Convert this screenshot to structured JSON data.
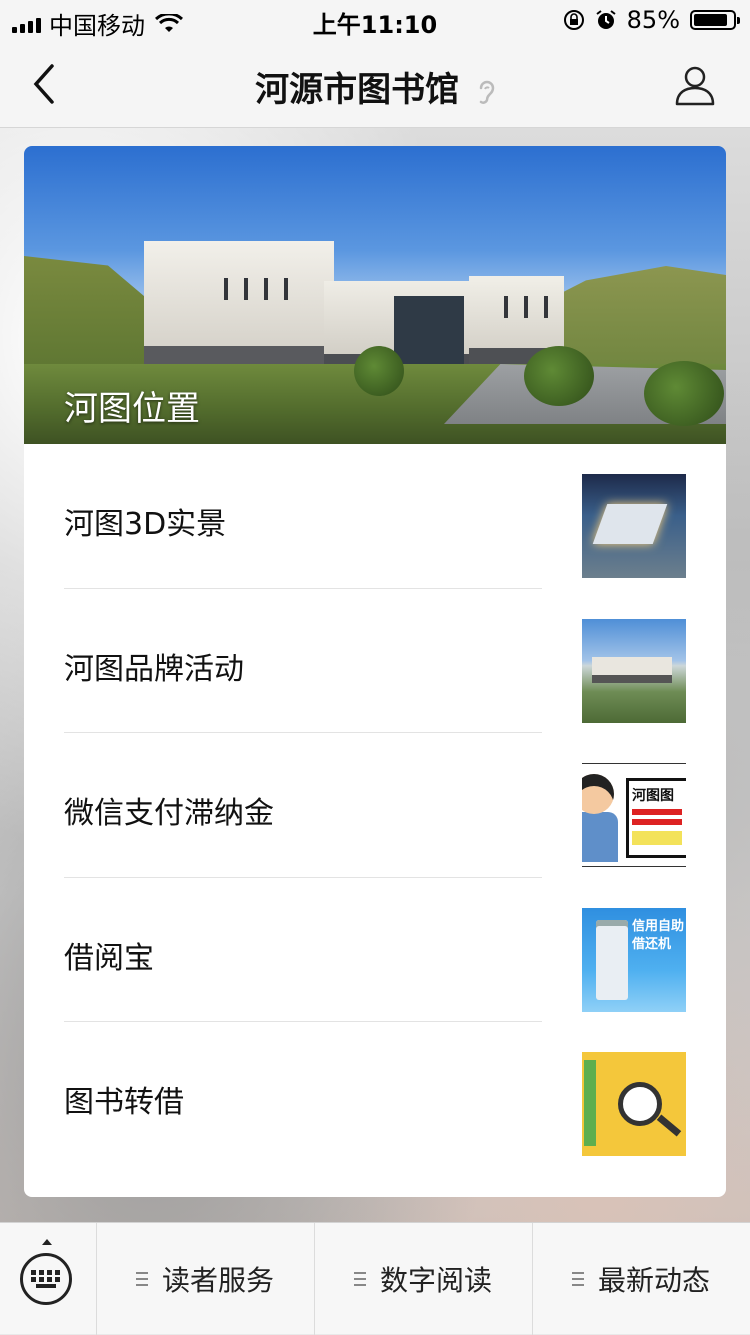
{
  "status_bar": {
    "carrier": "中国移动",
    "time": "上午11:10",
    "battery": "85%"
  },
  "nav": {
    "title": "河源市图书馆"
  },
  "hero": {
    "caption": "河图位置"
  },
  "list": [
    {
      "label": "河图3D实景",
      "thumb": "3d-building-render"
    },
    {
      "label": "河图品牌活动",
      "thumb": "library-photo"
    },
    {
      "label": "微信支付滞纳金",
      "thumb": "cartoon-sign",
      "thumb_text": "河图图"
    },
    {
      "label": "借阅宝",
      "thumb": "self-service-kiosk",
      "thumb_text": "信用自助 借还机"
    },
    {
      "label": "图书转借",
      "thumb": "magnifier-poster"
    }
  ],
  "menu": {
    "tabs": [
      "读者服务",
      "数字阅读",
      "最新动态"
    ]
  },
  "colors": {
    "nav_bg": "#f5f5f5",
    "card_bg": "#ffffff",
    "text": "#111111"
  }
}
